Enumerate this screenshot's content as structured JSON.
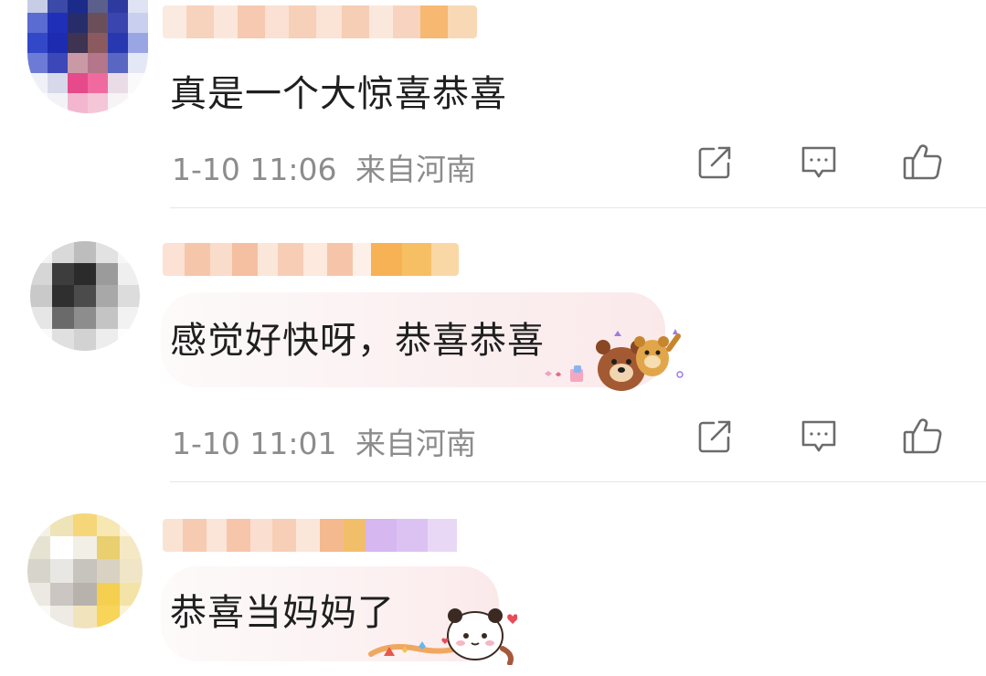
{
  "comments": [
    {
      "text": "真是一个大惊喜恭喜",
      "time": "1-10 11:06",
      "location": "来自河南"
    },
    {
      "text": "感觉好快呀，恭喜恭喜",
      "time": "1-10 11:01",
      "location": "来自河南"
    },
    {
      "text": "恭喜当妈妈了"
    }
  ],
  "icons": {
    "share": "share-icon",
    "reply": "comment-icon",
    "like": "thumbs-up-icon"
  },
  "colors": {
    "meta_text": "#8c8c8c",
    "main_text": "#1f1f1f",
    "divider": "#e6e6e6",
    "icon_stroke": "#6b6b6b"
  }
}
